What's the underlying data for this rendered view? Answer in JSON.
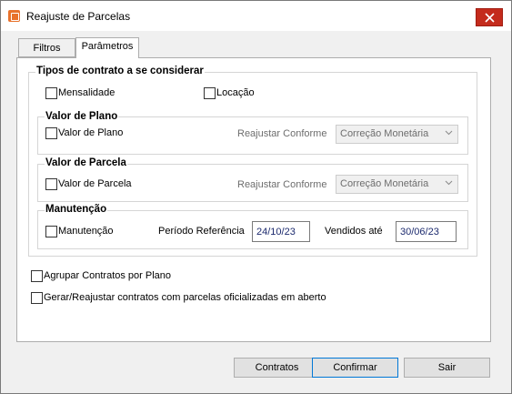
{
  "window": {
    "title": "Reajuste de Parcelas",
    "icon": "app-icon",
    "close": "close-icon"
  },
  "tabs": [
    {
      "label": "Filtros"
    },
    {
      "label": "Parâmetros"
    }
  ],
  "tipos": {
    "title": "Tipos de contrato a se considerar",
    "mensalidade": "Mensalidade",
    "locacao": "Locação"
  },
  "plano": {
    "title": "Valor de Plano",
    "checkbox": "Valor de Plano",
    "reajustar": "Reajustar Conforme",
    "combo": "Correção Monetária"
  },
  "parcela": {
    "title": "Valor de Parcela",
    "checkbox": "Valor de Parcela",
    "reajustar": "Reajustar Conforme",
    "combo": "Correção Monetária"
  },
  "manutencao": {
    "title": "Manutenção",
    "checkbox": "Manutenção",
    "periodo_label": "Período Referência",
    "periodo_value": "24/10/23",
    "vendidos_label": "Vendidos até",
    "vendidos_value": "30/06/23"
  },
  "options": {
    "agrupar": "Agrupar Contratos por Plano",
    "gerar": "Gerar/Reajustar contratos com parcelas oficializadas em aberto"
  },
  "buttons": {
    "contratos": "Contratos",
    "confirmar": "Confirmar",
    "sair": "Sair"
  },
  "colors": {
    "close": "#c42b1c",
    "accent": "#0078d7",
    "date_text": "#1c2a6e"
  }
}
